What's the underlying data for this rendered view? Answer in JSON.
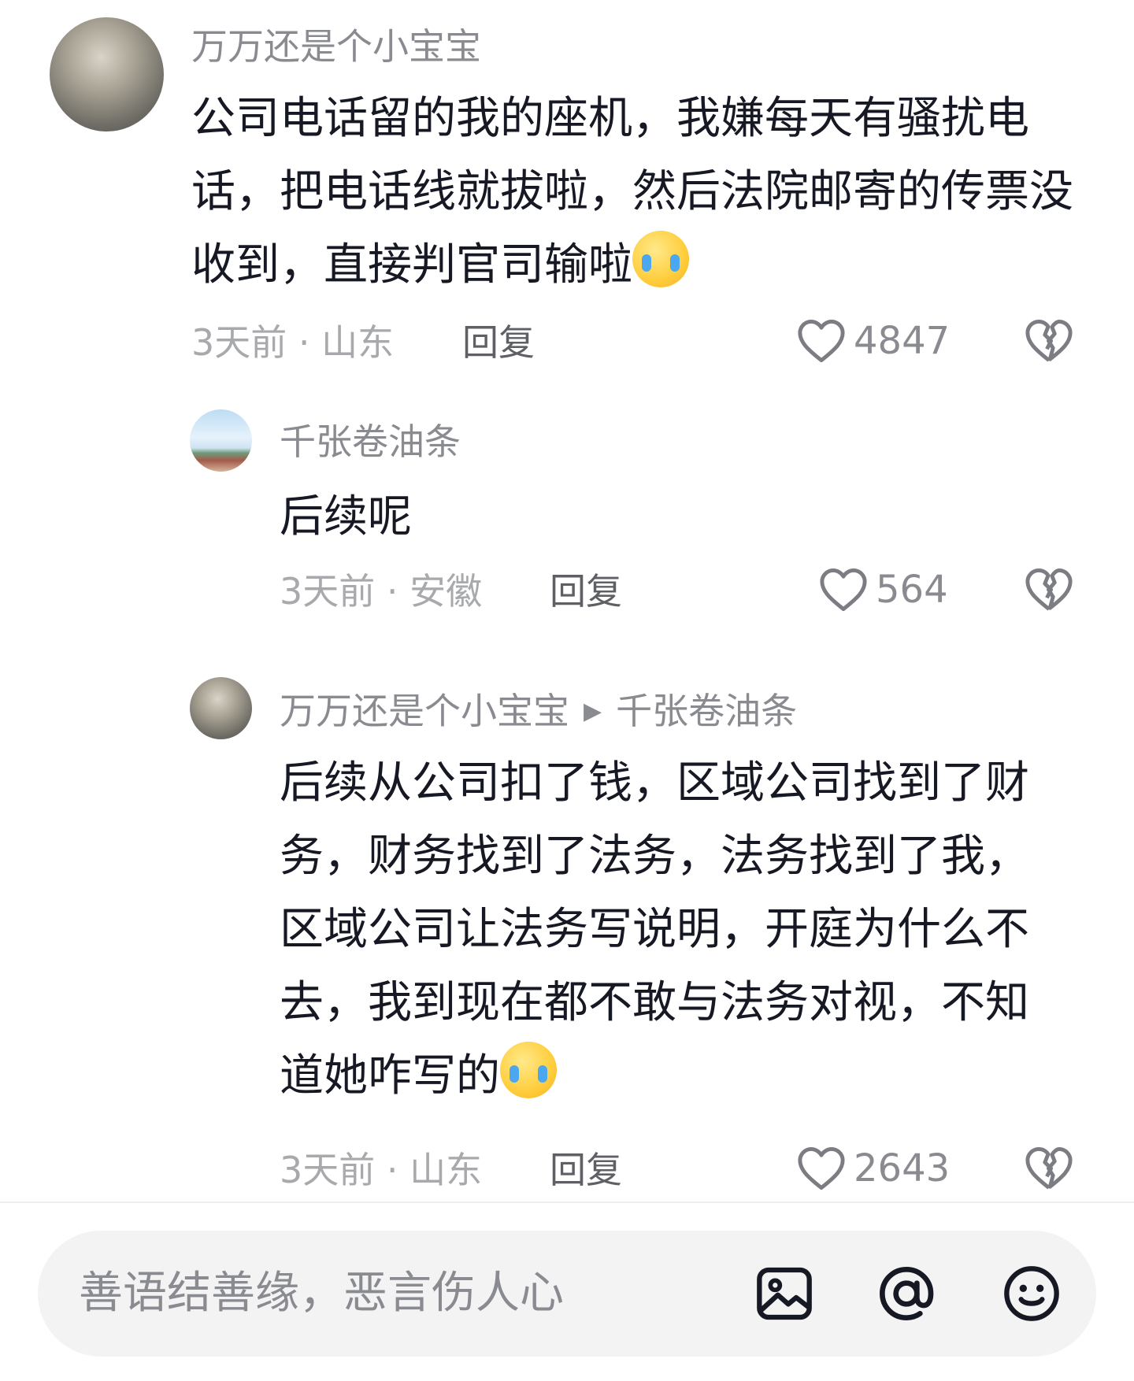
{
  "comments": [
    {
      "username": "万万还是个小宝宝",
      "content": "公司电话留的我的座机，我嫌每天有骚扰电话，把电话线就拔啦，然后法院邮寄的传票没收到，直接判官司输啦",
      "emoji": "laughing-tears-emoji",
      "time_location": "3天前 · 山东",
      "reply_label": "回复",
      "likes": "4847"
    },
    {
      "username": "千张卷油条",
      "content": "后续呢",
      "time_location": "3天前 · 安徽",
      "reply_label": "回复",
      "likes": "564"
    },
    {
      "username": "万万还是个小宝宝",
      "reply_to": "千张卷油条",
      "content": "后续从公司扣了钱，区域公司找到了财务，财务找到了法务，法务找到了我，区域公司让法务写说明，开庭为什么不去，我到现在都不敢与法务对视，不知道她咋写的",
      "emoji": "crying-emoji",
      "time_location": "3天前 · 山东",
      "reply_label": "回复",
      "likes": "2643"
    }
  ],
  "input": {
    "placeholder": "善语结善缘，恶言伤人心"
  },
  "icons": {
    "like": "heart-outline-icon",
    "dislike": "broken-heart-icon",
    "image": "image-icon",
    "mention": "at-icon",
    "emoji": "smiley-icon"
  },
  "colors": {
    "username": "#8a8b91",
    "meta": "#a8a9ad",
    "text": "#161823",
    "input_bg": "#f3f3f4"
  }
}
